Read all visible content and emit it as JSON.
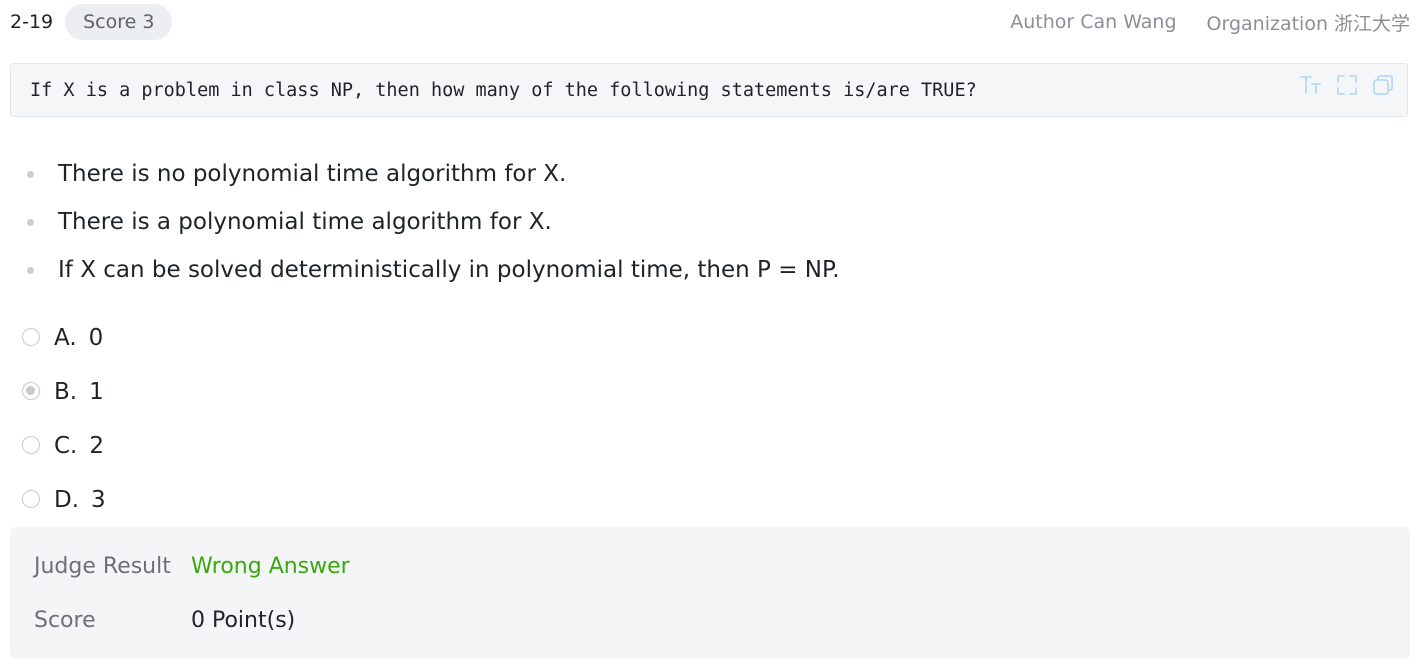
{
  "header": {
    "question_number": "2-19",
    "score_badge": "Score 3",
    "author_label": "Author",
    "author_name": "Can Wang",
    "organization_label": "Organization",
    "organization_name": "浙江大学"
  },
  "question": {
    "code_text": "If X is a problem in class NP, then how many of the following statements is/are TRUE?",
    "tools": [
      "font-size-icon",
      "fullscreen-icon",
      "copy-icon"
    ]
  },
  "statements": [
    "There is no polynomial time algorithm for X.",
    "There is a polynomial time algorithm for X.",
    "If X can be solved deterministically in polynomial time, then P = NP."
  ],
  "options": [
    {
      "letter": "A.",
      "text": "0",
      "selected": false
    },
    {
      "letter": "B.",
      "text": "1",
      "selected": true
    },
    {
      "letter": "C.",
      "text": "2",
      "selected": false
    },
    {
      "letter": "D.",
      "text": "3",
      "selected": false
    }
  ],
  "result": {
    "judge_label": "Judge Result",
    "judge_value": "Wrong Answer",
    "score_label": "Score",
    "score_value": "0 Point(s)"
  },
  "colors": {
    "wrong_answer": "#3aa70f",
    "icon_light": "#b8d8f4",
    "badge_bg": "#eceef1",
    "result_bg": "#f4f5f7"
  }
}
